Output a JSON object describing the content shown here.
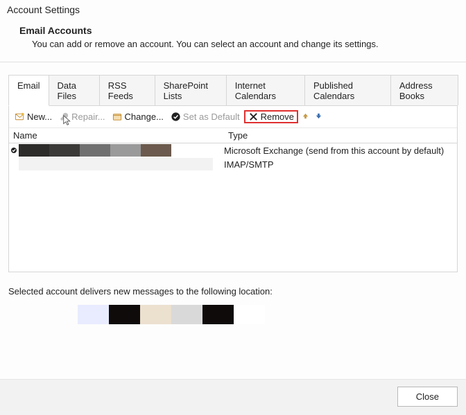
{
  "titlebar": {
    "title": "Account Settings"
  },
  "header": {
    "heading": "Email Accounts",
    "desc": "You can add or remove an account. You can select an account and change its settings."
  },
  "tabs": [
    {
      "label": "Email",
      "active": true
    },
    {
      "label": "Data Files"
    },
    {
      "label": "RSS Feeds"
    },
    {
      "label": "SharePoint Lists"
    },
    {
      "label": "Internet Calendars"
    },
    {
      "label": "Published Calendars"
    },
    {
      "label": "Address Books"
    }
  ],
  "toolbar": {
    "new": "New...",
    "repair": "Repair...",
    "change": "Change...",
    "set_default": "Set as Default",
    "remove": "Remove"
  },
  "columns": {
    "name": "Name",
    "type": "Type"
  },
  "rows": [
    {
      "default": true,
      "redacted": true,
      "type": "Microsoft Exchange (send from this account by default)"
    },
    {
      "default": false,
      "redacted": true,
      "type": "IMAP/SMTP"
    }
  ],
  "below": {
    "text": "Selected account delivers new messages to the following location:"
  },
  "footer": {
    "close": "Close"
  },
  "redact_colors_row1": [
    "#2e2c2b",
    "#3c3a39",
    "#707070",
    "#9a9a9a",
    "#6b5a4d"
  ],
  "redact_colors_row2": [
    "#f2f2f2",
    "#f2f2f2",
    "#f2f2f2",
    "#f2f2f2",
    "#f2f2f2"
  ],
  "redact_colors_loc": [
    "#e9ecff",
    "#0e0b0a",
    "#ece0cf",
    "#d9d9d9",
    "#0e0b0a",
    "#ffffff"
  ]
}
